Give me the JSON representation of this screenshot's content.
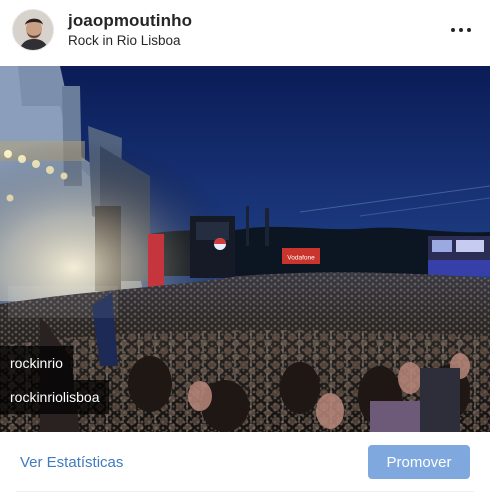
{
  "post": {
    "username": "joaopmoutinho",
    "location": "Rock in Rio Lisboa",
    "more_icon": "more-horizontal-icon"
  },
  "photo": {
    "tags": [
      "rockinrio",
      "rockinriolisboa"
    ],
    "sign_text": "Vodafone"
  },
  "footer": {
    "stats_label": "Ver Estatísticas",
    "promote_label": "Promover"
  },
  "colors": {
    "link": "#3f7bc0",
    "button": "#7ea8de",
    "text": "#262626"
  }
}
